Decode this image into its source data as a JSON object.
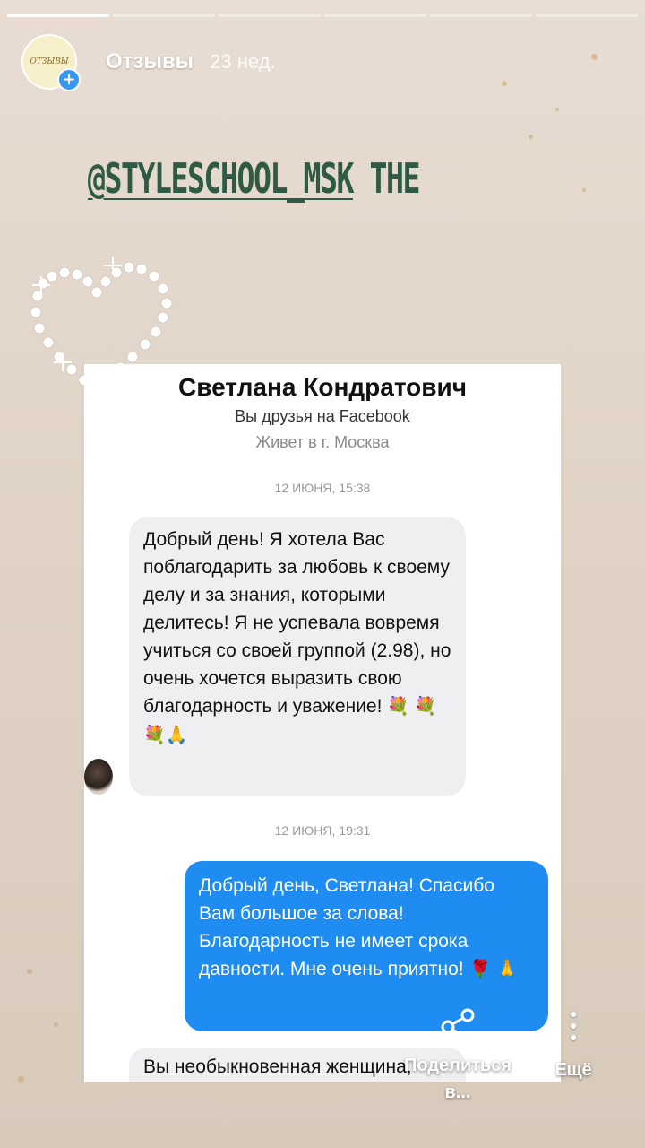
{
  "story": {
    "progress_total": 6,
    "progress_done": 1,
    "profile_avatar_text": "ОТЗЫВЫ",
    "username": "Отзывы",
    "posted_ago": "23 нед.",
    "handle_underlined": "@STYLESCHOOL_MSK",
    "handle_rest": " THE"
  },
  "chat": {
    "contact_name": "Светлана Кондратович",
    "friend_status": "Вы друзья на Facebook",
    "location": "Живет в г. Москва",
    "timestamp_1": "12 ИЮНЯ, 15:38",
    "incoming_message_1": "Добрый день! Я хотела Вас поблагодарить за любовь к своему делу и за знания, которыми делитесь! Я не успевала вовремя учиться со своей группой (2.98), но очень хочется выразить свою благодарность и уважение!",
    "incoming_message_1_emoji": "💐 💐💐🙏",
    "timestamp_2": "12 ИЮНЯ, 19:31",
    "outgoing_message": "Добрый день, Светлана! Спасибо Вам большое за слова! Благодарность не имеет срока давности. Мне очень приятно!",
    "outgoing_message_emoji": "🌹 🙏",
    "incoming_message_2": "Вы необыкновенная женщина,"
  },
  "actions": {
    "share_label": "Поделиться в...",
    "more_label": "Ещё",
    "share_icon": "share-icon",
    "more_icon": "more-vertical-icon"
  },
  "colors": {
    "progress_active": "#ffffff",
    "handle_text": "#2f5a44",
    "outgoing_bubble": "#1e8cf0",
    "incoming_bubble": "#efeff1"
  }
}
